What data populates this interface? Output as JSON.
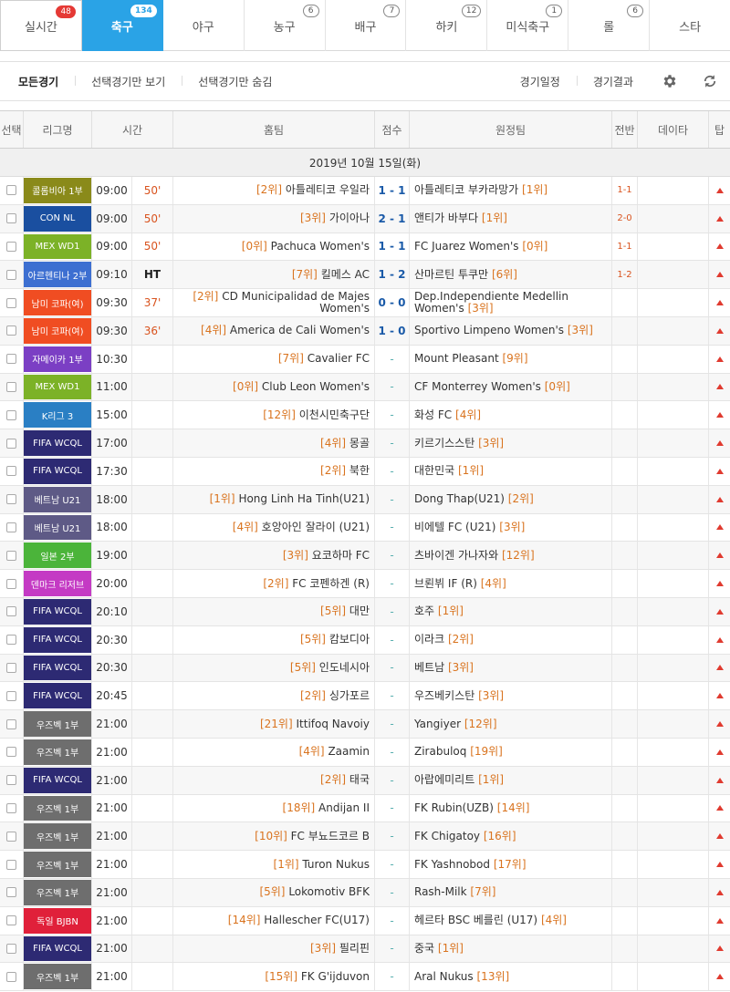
{
  "sport_tabs": [
    {
      "label": "실시간",
      "badge": "48",
      "badge_style": "red"
    },
    {
      "label": "축구",
      "badge": "134",
      "badge_style": "white",
      "active": true
    },
    {
      "label": "야구",
      "badge": ""
    },
    {
      "label": "농구",
      "badge": "6"
    },
    {
      "label": "배구",
      "badge": "7"
    },
    {
      "label": "하키",
      "badge": "12"
    },
    {
      "label": "미식축구",
      "badge": "1"
    },
    {
      "label": "롤",
      "badge": "6"
    },
    {
      "label": "스타",
      "badge": ""
    }
  ],
  "filters": {
    "all": "모든경기",
    "show_selected": "선택경기만 보기",
    "hide_selected": "선택경기만 숨김",
    "schedule": "경기일정",
    "results": "경기결과"
  },
  "icons": {
    "settings": "gear-icon",
    "refresh": "refresh-icon"
  },
  "columns": {
    "select": "선택",
    "league": "리그명",
    "time": "시간",
    "home": "홈팀",
    "score": "점수",
    "away": "원정팀",
    "half": "전반",
    "data": "데이타",
    "tip": "탑"
  },
  "date": "2019년 10월 15일(화)",
  "league_colors": {
    "콜롬비아 1부": "#8a8a1a",
    "CON NL": "#1a4fa0",
    "MEX WD1": "#7cb227",
    "아르헨티나 2부": "#3d6fd1",
    "남미 코파(여)": "#f04d22",
    "자메이카 1부": "#7b3fc4",
    "K리그 3": "#2a7fc4",
    "FIFA WCQL": "#2d2a73",
    "베트남 U21": "#5e5a86",
    "일본 2부": "#4bb43a",
    "덴마크 리저브": "#c43ac4",
    "우즈벡 1부": "#6e6e6e",
    "독일 BJBN": "#e0203a"
  },
  "matches": [
    {
      "league": "콜롬비아 1부",
      "time": "09:00",
      "minute": "50'",
      "home_rank": "[2위]",
      "home": "아틀레티코 우일라",
      "score": "1 - 1",
      "away": "아틀레티코 부카라망가",
      "away_rank": "[1위]",
      "half": "1-1"
    },
    {
      "league": "CON NL",
      "time": "09:00",
      "minute": "50'",
      "home_rank": "[3위]",
      "home": "가이아나",
      "score": "2 - 1",
      "away": "앤티가 바부다",
      "away_rank": "[1위]",
      "half": "2-0"
    },
    {
      "league": "MEX WD1",
      "time": "09:00",
      "minute": "50'",
      "home_rank": "[0위]",
      "home": "Pachuca Women's",
      "score": "1 - 1",
      "away": "FC Juarez Women's",
      "away_rank": "[0위]",
      "half": "1-1"
    },
    {
      "league": "아르헨티나 2부",
      "time": "09:10",
      "minute": "HT",
      "home_rank": "[7위]",
      "home": "킬메스 AC",
      "score": "1 - 2",
      "away": "산마르틴 투쿠만",
      "away_rank": "[6위]",
      "half": "1-2"
    },
    {
      "league": "남미 코파(여)",
      "time": "09:30",
      "minute": "37'",
      "home_rank": "[2위]",
      "home": "CD Municipalidad de Majes Women's",
      "score": "0 - 0",
      "away": "Dep.Independiente Medellin Women's",
      "away_rank": "[3위]",
      "half": ""
    },
    {
      "league": "남미 코파(여)",
      "time": "09:30",
      "minute": "36'",
      "home_rank": "[4위]",
      "home": "America de Cali Women's",
      "score": "1 - 0",
      "away": "Sportivo Limpeno Women's",
      "away_rank": "[3위]",
      "half": ""
    },
    {
      "league": "자메이카 1부",
      "time": "10:30",
      "minute": "",
      "home_rank": "[7위]",
      "home": "Cavalier FC",
      "score": "-",
      "away": "Mount Pleasant",
      "away_rank": "[9위]",
      "half": ""
    },
    {
      "league": "MEX WD1",
      "time": "11:00",
      "minute": "",
      "home_rank": "[0위]",
      "home": "Club Leon Women's",
      "score": "-",
      "away": "CF Monterrey Women's",
      "away_rank": "[0위]",
      "half": ""
    },
    {
      "league": "K리그 3",
      "time": "15:00",
      "minute": "",
      "home_rank": "[12위]",
      "home": "이천시민축구단",
      "score": "-",
      "away": "화성 FC",
      "away_rank": "[4위]",
      "half": ""
    },
    {
      "league": "FIFA WCQL",
      "time": "17:00",
      "minute": "",
      "home_rank": "[4위]",
      "home": "몽골",
      "score": "-",
      "away": "키르기스스탄",
      "away_rank": "[3위]",
      "half": ""
    },
    {
      "league": "FIFA WCQL",
      "time": "17:30",
      "minute": "",
      "home_rank": "[2위]",
      "home": "북한",
      "score": "-",
      "away": "대한민국",
      "away_rank": "[1위]",
      "half": ""
    },
    {
      "league": "베트남 U21",
      "time": "18:00",
      "minute": "",
      "home_rank": "[1위]",
      "home": "Hong Linh Ha Tinh(U21)",
      "score": "-",
      "away": "Dong Thap(U21)",
      "away_rank": "[2위]",
      "half": ""
    },
    {
      "league": "베트남 U21",
      "time": "18:00",
      "minute": "",
      "home_rank": "[4위]",
      "home": "호앙아인 잘라이 (U21)",
      "score": "-",
      "away": "비에텔 FC (U21)",
      "away_rank": "[3위]",
      "half": ""
    },
    {
      "league": "일본 2부",
      "time": "19:00",
      "minute": "",
      "home_rank": "[3위]",
      "home": "요코하마 FC",
      "score": "-",
      "away": "츠바이겐 가나자와",
      "away_rank": "[12위]",
      "half": ""
    },
    {
      "league": "덴마크 리저브",
      "time": "20:00",
      "minute": "",
      "home_rank": "[2위]",
      "home": "FC 코펜하겐 (R)",
      "score": "-",
      "away": "브뢴뷔 IF (R)",
      "away_rank": "[4위]",
      "half": ""
    },
    {
      "league": "FIFA WCQL",
      "time": "20:10",
      "minute": "",
      "home_rank": "[5위]",
      "home": "대만",
      "score": "-",
      "away": "호주",
      "away_rank": "[1위]",
      "half": ""
    },
    {
      "league": "FIFA WCQL",
      "time": "20:30",
      "minute": "",
      "home_rank": "[5위]",
      "home": "캄보디아",
      "score": "-",
      "away": "이라크",
      "away_rank": "[2위]",
      "half": ""
    },
    {
      "league": "FIFA WCQL",
      "time": "20:30",
      "minute": "",
      "home_rank": "[5위]",
      "home": "인도네시아",
      "score": "-",
      "away": "베트남",
      "away_rank": "[3위]",
      "half": ""
    },
    {
      "league": "FIFA WCQL",
      "time": "20:45",
      "minute": "",
      "home_rank": "[2위]",
      "home": "싱가포르",
      "score": "-",
      "away": "우즈베키스탄",
      "away_rank": "[3위]",
      "half": ""
    },
    {
      "league": "우즈벡 1부",
      "time": "21:00",
      "minute": "",
      "home_rank": "[21위]",
      "home": "Ittifoq Navoiy",
      "score": "-",
      "away": "Yangiyer",
      "away_rank": "[12위]",
      "half": ""
    },
    {
      "league": "우즈벡 1부",
      "time": "21:00",
      "minute": "",
      "home_rank": "[4위]",
      "home": "Zaamin",
      "score": "-",
      "away": "Zirabuloq",
      "away_rank": "[19위]",
      "half": ""
    },
    {
      "league": "FIFA WCQL",
      "time": "21:00",
      "minute": "",
      "home_rank": "[2위]",
      "home": "태국",
      "score": "-",
      "away": "아랍에미리트",
      "away_rank": "[1위]",
      "half": ""
    },
    {
      "league": "우즈벡 1부",
      "time": "21:00",
      "minute": "",
      "home_rank": "[18위]",
      "home": "Andijan II",
      "score": "-",
      "away": "FK Rubin(UZB)",
      "away_rank": "[14위]",
      "half": ""
    },
    {
      "league": "우즈벡 1부",
      "time": "21:00",
      "minute": "",
      "home_rank": "[10위]",
      "home": "FC 부뇨드코르 B",
      "score": "-",
      "away": "FK Chigatoy",
      "away_rank": "[16위]",
      "half": ""
    },
    {
      "league": "우즈벡 1부",
      "time": "21:00",
      "minute": "",
      "home_rank": "[1위]",
      "home": "Turon Nukus",
      "score": "-",
      "away": "FK Yashnobod",
      "away_rank": "[17위]",
      "half": ""
    },
    {
      "league": "우즈벡 1부",
      "time": "21:00",
      "minute": "",
      "home_rank": "[5위]",
      "home": "Lokomotiv BFK",
      "score": "-",
      "away": "Rash-Milk",
      "away_rank": "[7위]",
      "half": ""
    },
    {
      "league": "독일 BJBN",
      "time": "21:00",
      "minute": "",
      "home_rank": "[14위]",
      "home": "Hallescher FC(U17)",
      "score": "-",
      "away": "헤르타 BSC 베를린 (U17)",
      "away_rank": "[4위]",
      "half": ""
    },
    {
      "league": "FIFA WCQL",
      "time": "21:00",
      "minute": "",
      "home_rank": "[3위]",
      "home": "필리핀",
      "score": "-",
      "away": "중국",
      "away_rank": "[1위]",
      "half": ""
    },
    {
      "league": "우즈벡 1부",
      "time": "21:00",
      "minute": "",
      "home_rank": "[15위]",
      "home": "FK G'ijduvon",
      "score": "-",
      "away": "Aral Nukus",
      "away_rank": "[13위]",
      "half": ""
    }
  ]
}
